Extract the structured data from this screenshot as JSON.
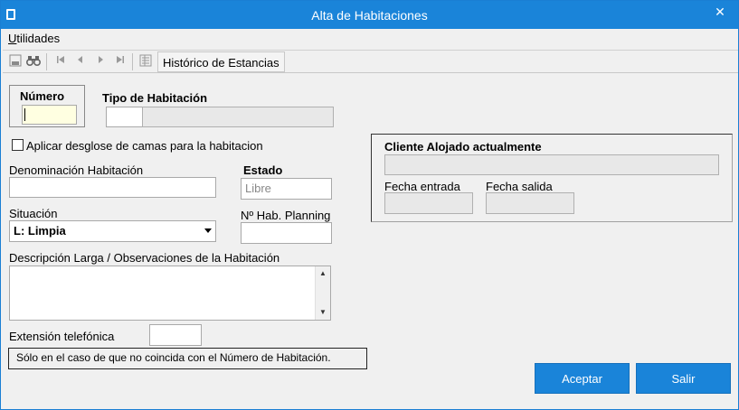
{
  "window": {
    "title": "Alta de Habitaciones",
    "close_glyph": "✕"
  },
  "menu": {
    "utilidades_first": "U",
    "utilidades_rest": "tilidades"
  },
  "toolbar": {
    "icons": [
      "save-icon",
      "binoculars-icon",
      "first-record-icon",
      "previous-record-icon",
      "next-record-icon",
      "last-record-icon",
      "list-icon"
    ],
    "historico_label": "Histórico de Estancias"
  },
  "form": {
    "numero_label": "Número",
    "numero_value": "",
    "tipo_label": "Tipo de Habitación",
    "tipo_code": "",
    "tipo_desc": "",
    "desglose_label": "Aplicar desglose de camas para la habitacion",
    "desglose_checked": false,
    "denominacion_label": "Denominación Habitación",
    "denominacion_value": "",
    "estado_label": "Estado",
    "estado_value": "Libre",
    "situacion_label": "Situación",
    "situacion_value": "L: Limpia",
    "planning_label": "Nº Hab. Planning",
    "planning_value": "",
    "descripcion_label": "Descripción Larga / Observaciones de la Habitación",
    "descripcion_value": "",
    "extension_label": "Extensión telefónica",
    "extension_value": "",
    "extension_note": "Sólo en el caso de que no coincida con el Número de Habitación."
  },
  "client": {
    "title": "Cliente Alojado actualmente",
    "name_value": "",
    "entrada_label": "Fecha entrada",
    "entrada_value": "",
    "salida_label": "Fecha salida",
    "salida_value": ""
  },
  "buttons": {
    "aceptar": "Aceptar",
    "salir": "Salir"
  },
  "colors": {
    "accent": "#1a84d9",
    "focus_field": "#ffffe1",
    "readonly_field": "#e8e8e8"
  }
}
